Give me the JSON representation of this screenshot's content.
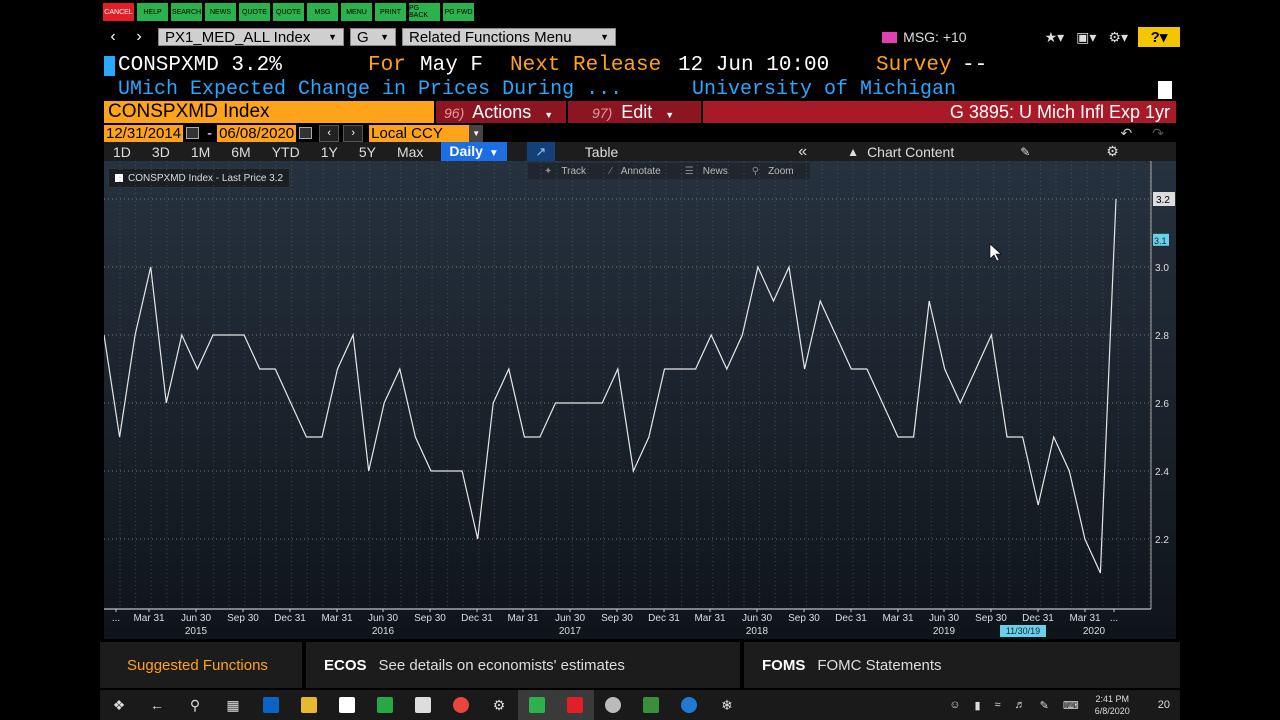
{
  "fkeys": [
    "CANCEL",
    "HELP",
    "SEARCH",
    "NEWS",
    "QUOTE",
    "QUOTE",
    "MSG",
    "MENU",
    "PRINT",
    "PG BACK",
    "PG FWD"
  ],
  "toolbar": {
    "security_field": "PX1_MED_ALL Index",
    "g_field": "G",
    "related_menu": "Related Functions Menu",
    "msg": "MSG: +10",
    "help": "?"
  },
  "header": {
    "ticker": "CONSPXMD 3.2%",
    "for_label": "For",
    "for_value": "May F",
    "next_release_label": "Next Release",
    "next_release_value": "12 Jun 10:00",
    "survey_label": "Survey",
    "survey_value": "--",
    "description": "UMich Expected Change in Prices During ...",
    "source": "University of Michigan"
  },
  "menu": {
    "security_name": "CONSPXMD Index",
    "actions_num": "96)",
    "actions_label": "Actions",
    "edit_num": "97)",
    "edit_label": "Edit",
    "graph_title": "G 3895: U Mich Infl Exp 1yr"
  },
  "dates": {
    "start": "12/31/2014",
    "end": "06/08/2020",
    "currency": "Local CCY"
  },
  "periods": [
    "1D",
    "3D",
    "1M",
    "6M",
    "YTD",
    "1Y",
    "5Y",
    "Max"
  ],
  "frequency": "Daily",
  "view": {
    "table_label": "Table",
    "chart_content_label": "Chart Content"
  },
  "chart_tools": [
    "Track",
    "Annotate",
    "News",
    "Zoom"
  ],
  "legend": "CONSPXMD Index - Last Price 3.2",
  "chart_data": {
    "type": "line",
    "title": "",
    "xlabel": "",
    "ylabel": "",
    "ylim": [
      2.0,
      3.2
    ],
    "y_ticks": [
      "2.2",
      "2.4",
      "2.6",
      "2.8",
      "3.0",
      "3.2"
    ],
    "last_price_label": "3.2",
    "crosshair_label": "3.1",
    "x_tick_labels": [
      "...",
      "Mar 31",
      "Jun 30",
      "Sep 30",
      "Dec 31",
      "Mar 31",
      "Jun 30",
      "Sep 30",
      "Dec 31",
      "Mar 31",
      "Jun 30",
      "Sep 30",
      "Dec 31",
      "Mar 31",
      "Jun 30",
      "Sep 30",
      "Dec 31",
      "Mar 31",
      "Jun 30",
      "Sep 30",
      "Dec 31",
      "Mar 31",
      "..."
    ],
    "x_year_labels": [
      "2015",
      "2016",
      "2017",
      "2018",
      "2019",
      "2020"
    ],
    "highlight_date": "11/30/19",
    "series": [
      {
        "name": "CONSPXMD Index - Last Price",
        "x": [
          "2014-12",
          "2015-01",
          "2015-02",
          "2015-03",
          "2015-04",
          "2015-05",
          "2015-06",
          "2015-07",
          "2015-08",
          "2015-09",
          "2015-10",
          "2015-11",
          "2015-12",
          "2016-01",
          "2016-02",
          "2016-03",
          "2016-04",
          "2016-05",
          "2016-06",
          "2016-07",
          "2016-08",
          "2016-09",
          "2016-10",
          "2016-11",
          "2016-12",
          "2017-01",
          "2017-02",
          "2017-03",
          "2017-04",
          "2017-05",
          "2017-06",
          "2017-07",
          "2017-08",
          "2017-09",
          "2017-10",
          "2017-11",
          "2017-12",
          "2018-01",
          "2018-02",
          "2018-03",
          "2018-04",
          "2018-05",
          "2018-06",
          "2018-07",
          "2018-08",
          "2018-09",
          "2018-10",
          "2018-11",
          "2018-12",
          "2019-01",
          "2019-02",
          "2019-03",
          "2019-04",
          "2019-05",
          "2019-06",
          "2019-07",
          "2019-08",
          "2019-09",
          "2019-10",
          "2019-11",
          "2019-12",
          "2020-01",
          "2020-02",
          "2020-03",
          "2020-04",
          "2020-05"
        ],
        "values": [
          2.8,
          2.5,
          2.8,
          3.0,
          2.6,
          2.8,
          2.7,
          2.8,
          2.8,
          2.8,
          2.7,
          2.7,
          2.6,
          2.5,
          2.5,
          2.7,
          2.8,
          2.4,
          2.6,
          2.7,
          2.5,
          2.4,
          2.4,
          2.4,
          2.2,
          2.6,
          2.7,
          2.5,
          2.5,
          2.6,
          2.6,
          2.6,
          2.6,
          2.7,
          2.4,
          2.5,
          2.7,
          2.7,
          2.7,
          2.8,
          2.7,
          2.8,
          3.0,
          2.9,
          3.0,
          2.7,
          2.9,
          2.8,
          2.7,
          2.7,
          2.6,
          2.5,
          2.5,
          2.9,
          2.7,
          2.6,
          2.7,
          2.8,
          2.5,
          2.5,
          2.3,
          2.5,
          2.4,
          2.2,
          2.1,
          3.2
        ]
      }
    ],
    "line_color": "#e6e6e6",
    "grid": true
  },
  "suggested": {
    "title": "Suggested Functions",
    "item1_code": "ECOS",
    "item1_text": "See details on economists' estimates",
    "item2_code": "FOMS",
    "item2_text": "FOMC Statements"
  },
  "taskbar": {
    "time": "2:41 PM",
    "date": "6/8/2020",
    "notifications": "20"
  }
}
